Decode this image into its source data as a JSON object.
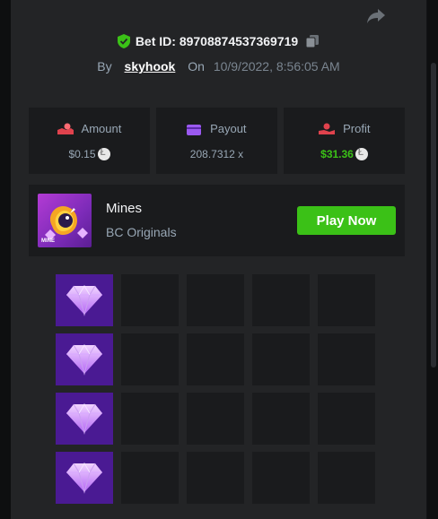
{
  "bet": {
    "id_label": "Bet ID: 89708874537369719",
    "by_label": "By",
    "username": "skyhook",
    "on_label": "On",
    "date": "10/9/2022, 8:56:05 AM"
  },
  "stats": {
    "amount_label": "Amount",
    "amount_value": "$0.15",
    "payout_label": "Payout",
    "payout_value": "208.7312 x",
    "profit_label": "Profit",
    "profit_value": "$31.36"
  },
  "game": {
    "name": "Mines",
    "provider": "BC Originals",
    "thumb_text": "MINE",
    "play_label": "Play Now"
  },
  "grid": {
    "columns": 5,
    "rows": [
      [
        "gem",
        "empty",
        "empty",
        "empty",
        "empty"
      ],
      [
        "gem",
        "empty",
        "empty",
        "empty",
        "empty"
      ],
      [
        "gem",
        "empty",
        "empty",
        "empty",
        "empty"
      ],
      [
        "gem",
        "empty",
        "empty",
        "empty",
        "empty"
      ]
    ]
  },
  "colors": {
    "accent_green": "#3bc117",
    "gem_tile": "#4a1a93",
    "panel": "#232426",
    "card": "#1a1b1d"
  },
  "icons": {
    "share": "share-arrow-icon",
    "shield": "shield-check-icon",
    "copy": "copy-icon",
    "amount": "hand-coin-icon",
    "payout": "card-icon",
    "profit": "hand-money-icon",
    "coin": "litecoin-icon",
    "gem": "diamond-icon"
  }
}
